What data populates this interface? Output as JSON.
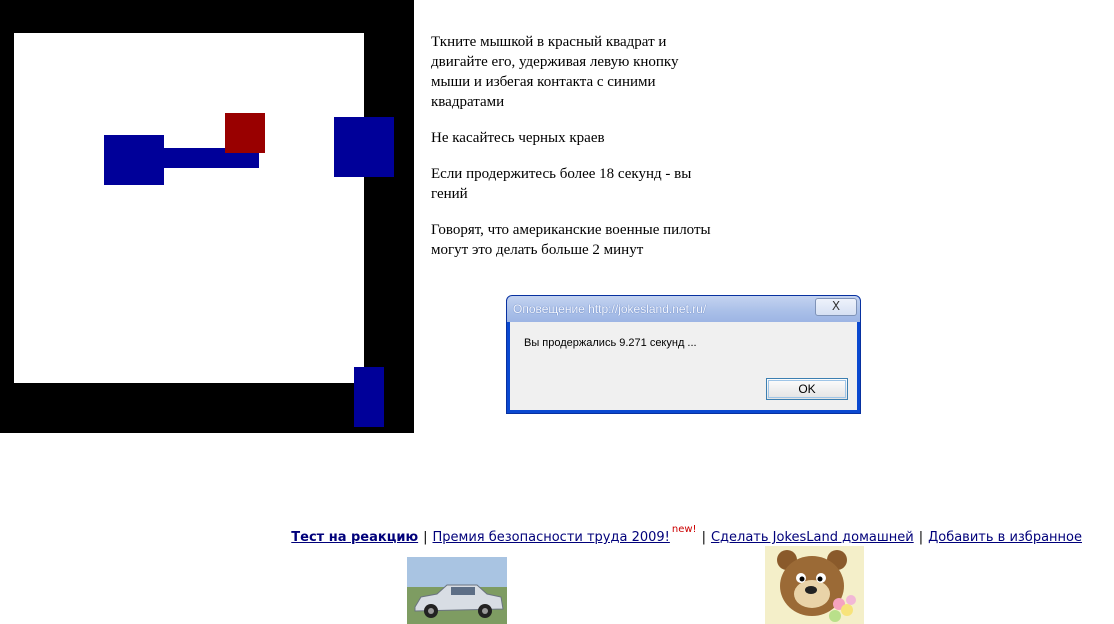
{
  "instructions": {
    "p1": "Ткните мышкой в красный квадрат и двигайте его, удерживая левую кнопку мыши и избегая контакта с синими квадратами",
    "p2": "Не касайтесь черных краев",
    "p3": "Если продержитесь более 18 секунд - вы гений",
    "p4": "Говорят, что американские военные пилоты могут это делать больше 2 минут"
  },
  "alert": {
    "title": "Оповещение http://jokesland.net.ru/",
    "close_label": "X",
    "message": "Вы продержались 9.271 секунд ...",
    "ok_label": "OK"
  },
  "footer": {
    "link1": "Тест на реакцию",
    "link2": "Премия безопасности труда 2009!",
    "new_badge": "new!",
    "link3": "Сделать JokesLand домашней",
    "link4": "Добавить в избранное",
    "separator": "|"
  },
  "colors": {
    "border": "#000000",
    "enemy": "#000099",
    "player": "#990000"
  }
}
